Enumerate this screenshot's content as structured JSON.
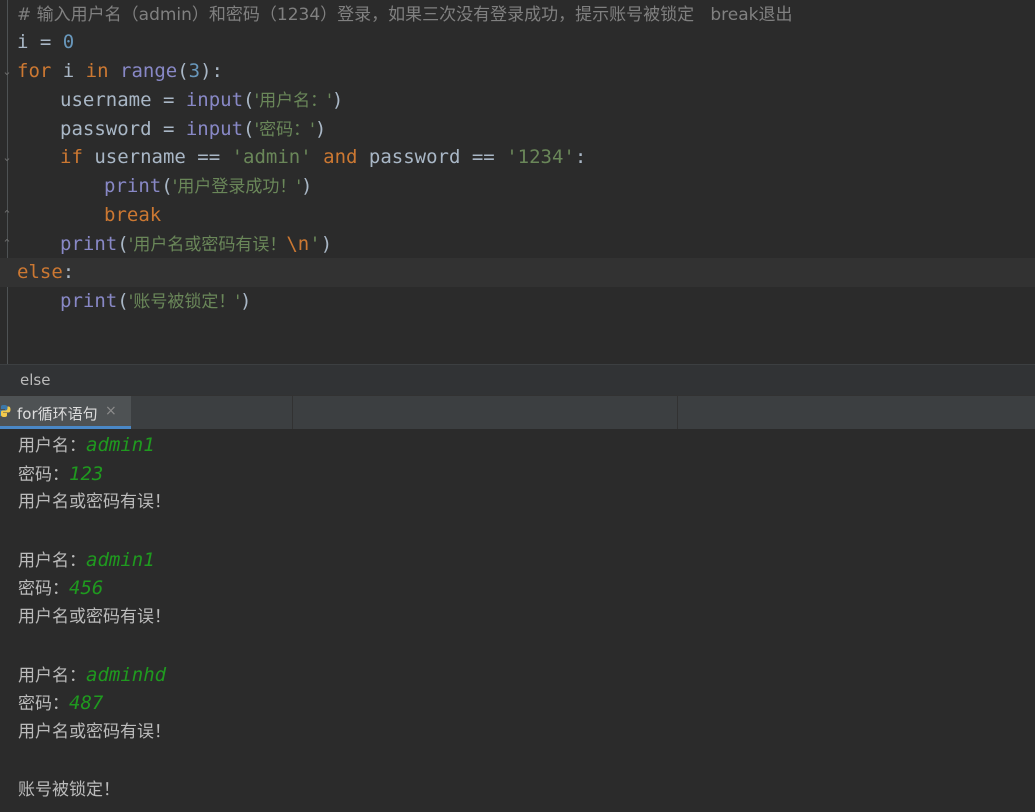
{
  "editor": {
    "comment": "# 输入用户名（admin）和密码（1234）登录，如果三次没有登录成功，提示账号被锁定   break退出",
    "line1": {
      "var": "i",
      "op": " = ",
      "num": "0"
    },
    "line2": {
      "kw_for": "for",
      "var": " i ",
      "kw_in": "in",
      "sp": " ",
      "fn": "range",
      "open": "(",
      "num": "3",
      "close": "):"
    },
    "line3": {
      "lhs": "username = ",
      "fn": "input",
      "open": "(",
      "str": "'用户名：'",
      "close": ")"
    },
    "line4": {
      "lhs": "password = ",
      "fn": "input",
      "open": "(",
      "str": "'密码：'",
      "close": ")"
    },
    "line5": {
      "kw_if": "if",
      "a": " username == ",
      "s1": "'admin'",
      "sp1": " ",
      "kw_and": "and",
      "b": " password == ",
      "s2": "'1234'",
      "colon": ":"
    },
    "line6": {
      "fn": "print",
      "open": "(",
      "str": "'用户登录成功！'",
      "close": ")"
    },
    "line7": {
      "kw": "break"
    },
    "line8": {
      "fn": "print",
      "open": "(",
      "str1": "'用户名或密码有误！",
      "esc": "\\n",
      "str2": "'",
      "close": ")"
    },
    "line9": {
      "kw": "else",
      "colon": ":"
    },
    "line10": {
      "fn": "print",
      "open": "(",
      "str": "'账号被锁定！'",
      "close": ")"
    }
  },
  "breadcrumb": {
    "label": "else"
  },
  "run_tab": {
    "label": "for循环语句",
    "close_glyph": "×",
    "icon": "python-icon"
  },
  "console": {
    "lines": [
      {
        "prompt": "用户名：",
        "input": "admin1"
      },
      {
        "prompt": "密码：",
        "input": "123"
      },
      {
        "text": "用户名或密码有误！"
      },
      {
        "prompt": "用户名：",
        "input": "admin1"
      },
      {
        "prompt": "密码：",
        "input": "456"
      },
      {
        "text": "用户名或密码有误！"
      },
      {
        "prompt": "用户名：",
        "input": "adminhd"
      },
      {
        "prompt": "密码：",
        "input": "487"
      },
      {
        "text": "用户名或密码有误！"
      },
      {
        "text": "账号被锁定！"
      }
    ]
  },
  "colors": {
    "editor_bg": "#2b2b2b",
    "keyword": "#cc7832",
    "string": "#6a8759",
    "number": "#6897bb",
    "builtin": "#8888c6",
    "comment": "#808080",
    "user_input": "#1f9a1f",
    "tab_accent": "#4a88c7"
  }
}
